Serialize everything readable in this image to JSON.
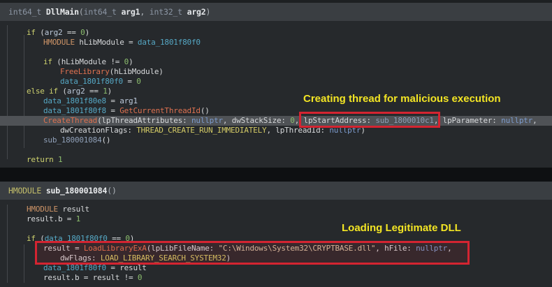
{
  "annotations": {
    "thread_label": "Creating thread for malicious execution",
    "dll_label": "Loading Legitimate DLL",
    "label_color": "#f3e524",
    "box_color": "#d42431"
  },
  "panes": [
    {
      "function_name": "DllMain",
      "header": [
        [
          "htype",
          "int64_t"
        ],
        [
          "hplain",
          " "
        ],
        [
          "hname",
          "DllMain"
        ],
        [
          "hplain",
          "("
        ],
        [
          "htype",
          "int64_t"
        ],
        [
          "hplain",
          " "
        ],
        [
          "harg",
          "arg1"
        ],
        [
          "hplain",
          ", "
        ],
        [
          "htype",
          "int32_t"
        ],
        [
          "hplain",
          " "
        ],
        [
          "harg",
          "arg2"
        ],
        [
          "hplain",
          ")"
        ]
      ],
      "lines": [
        {
          "ind": 1,
          "t": [
            [
              "kw",
              "if"
            ],
            [
              "plain",
              " ("
            ],
            [
              "var",
              "arg2"
            ],
            [
              "plain",
              " == "
            ],
            [
              "num",
              "0"
            ],
            [
              "plain",
              ")"
            ]
          ]
        },
        {
          "ind": 2,
          "t": [
            [
              "type",
              "HMODULE"
            ],
            [
              "plain",
              " hLibModule = "
            ],
            [
              "data",
              "data_1801f80f0"
            ]
          ]
        },
        {
          "ind": 0,
          "t": []
        },
        {
          "ind": 2,
          "t": [
            [
              "kw",
              "if"
            ],
            [
              "plain",
              " (hLibModule != "
            ],
            [
              "num",
              "0"
            ],
            [
              "plain",
              ")"
            ]
          ]
        },
        {
          "ind": 3,
          "t": [
            [
              "call",
              "FreeLibrary"
            ],
            [
              "plain",
              "(hLibModule)"
            ]
          ]
        },
        {
          "ind": 3,
          "t": [
            [
              "data",
              "data_1801f80f0"
            ],
            [
              "plain",
              " = "
            ],
            [
              "num",
              "0"
            ]
          ]
        },
        {
          "ind": 1,
          "t": [
            [
              "kw",
              "else if"
            ],
            [
              "plain",
              " ("
            ],
            [
              "var",
              "arg2"
            ],
            [
              "plain",
              " == "
            ],
            [
              "num",
              "1"
            ],
            [
              "plain",
              ")"
            ]
          ]
        },
        {
          "ind": 2,
          "t": [
            [
              "data",
              "data_1801f80e8"
            ],
            [
              "plain",
              " = "
            ],
            [
              "var",
              "arg1"
            ]
          ]
        },
        {
          "ind": 2,
          "t": [
            [
              "data",
              "data_1801f80f8"
            ],
            [
              "plain",
              " = "
            ],
            [
              "call",
              "GetCurrentThreadId"
            ],
            [
              "plain",
              "()"
            ]
          ]
        },
        {
          "ind": 2,
          "hl": true,
          "t": [
            [
              "call",
              "CreateThread"
            ],
            [
              "plain",
              "(lpThreadAttributes: "
            ],
            [
              "null",
              "nullptr"
            ],
            [
              "plain",
              ", dwStackSize: "
            ],
            [
              "num",
              "0"
            ],
            [
              "plain",
              ", lpStartAddress: "
            ],
            [
              "sub",
              "sub_1800010c1"
            ],
            [
              "plain",
              ", lpParameter: "
            ],
            [
              "null",
              "nullptr"
            ],
            [
              "plain",
              ","
            ]
          ]
        },
        {
          "ind": 3,
          "t": [
            [
              "plain",
              "dwCreationFlags: "
            ],
            [
              "const",
              "THREAD_CREATE_RUN_IMMEDIATELY"
            ],
            [
              "plain",
              ", lpThreadId: "
            ],
            [
              "null",
              "nullptr"
            ],
            [
              "plain",
              ")"
            ]
          ]
        },
        {
          "ind": 2,
          "t": [
            [
              "sub",
              "sub_180001084"
            ],
            [
              "plain",
              "()"
            ]
          ]
        },
        {
          "ind": 0,
          "t": []
        },
        {
          "ind": 1,
          "t": [
            [
              "kw",
              "return"
            ],
            [
              "plain",
              " "
            ],
            [
              "num",
              "1"
            ]
          ]
        }
      ]
    },
    {
      "function_name": "sub_180001084",
      "header": [
        [
          "htype2",
          "HMODULE"
        ],
        [
          "hplain",
          " "
        ],
        [
          "hname",
          "sub_180001084"
        ],
        [
          "hplain",
          "()"
        ]
      ],
      "lines": [
        {
          "ind": 1,
          "t": [
            [
              "type",
              "HMODULE"
            ],
            [
              "plain",
              " result"
            ]
          ]
        },
        {
          "ind": 1,
          "t": [
            [
              "plain",
              "result.b = "
            ],
            [
              "num",
              "1"
            ]
          ]
        },
        {
          "ind": 0,
          "t": []
        },
        {
          "ind": 1,
          "t": [
            [
              "kw",
              "if"
            ],
            [
              "plain",
              " ("
            ],
            [
              "data",
              "data_1801f80f0"
            ],
            [
              "plain",
              " == "
            ],
            [
              "num",
              "0"
            ],
            [
              "plain",
              ")"
            ]
          ]
        },
        {
          "ind": 2,
          "t": [
            [
              "plain",
              "result = "
            ],
            [
              "call",
              "LoadLibraryExA"
            ],
            [
              "plain",
              "(lpLibFileName: "
            ],
            [
              "str",
              "\"C:\\Windows\\System32\\CRYPTBASE.dll\""
            ],
            [
              "plain",
              ", hFile: "
            ],
            [
              "null",
              "nullptr"
            ],
            [
              "plain",
              ","
            ]
          ]
        },
        {
          "ind": 3,
          "t": [
            [
              "plain",
              "dwFlags: "
            ],
            [
              "const",
              "LOAD_LIBRARY_SEARCH_SYSTEM32"
            ],
            [
              "plain",
              ")"
            ]
          ]
        },
        {
          "ind": 2,
          "t": [
            [
              "data",
              "data_1801f80f0"
            ],
            [
              "plain",
              " = result"
            ]
          ]
        },
        {
          "ind": 2,
          "t": [
            [
              "plain",
              "result.b = result != "
            ],
            [
              "num",
              "0"
            ]
          ]
        }
      ]
    }
  ]
}
